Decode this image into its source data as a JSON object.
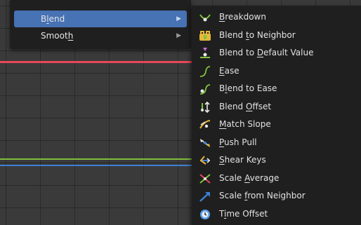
{
  "parent_menu": {
    "items": [
      {
        "pre": "B",
        "ul": "l",
        "post": "end",
        "active": true
      },
      {
        "pre": "Smoot",
        "ul": "h",
        "post": "",
        "active": false
      }
    ]
  },
  "blend_menu": {
    "items": [
      {
        "pre": "",
        "ul": "B",
        "post": "reakdown",
        "icon": "breakdown-icon"
      },
      {
        "pre": "Blend ",
        "ul": "t",
        "post": "o Neighbor",
        "icon": "blend-to-neighbor-icon"
      },
      {
        "pre": "Blend to ",
        "ul": "D",
        "post": "efault Value",
        "icon": "blend-to-default-icon"
      },
      {
        "pre": "",
        "ul": "E",
        "post": "ase",
        "icon": "ease-icon"
      },
      {
        "pre": "B",
        "ul": "l",
        "post": "end to Ease",
        "icon": "blend-to-ease-icon"
      },
      {
        "pre": "Blend ",
        "ul": "O",
        "post": "ffset",
        "icon": "blend-offset-icon"
      },
      {
        "pre": "",
        "ul": "M",
        "post": "atch Slope",
        "icon": "match-slope-icon"
      },
      {
        "pre": "",
        "ul": "P",
        "post": "ush Pull",
        "icon": "push-pull-icon"
      },
      {
        "pre": "",
        "ul": "S",
        "post": "hear Keys",
        "icon": "shear-keys-icon"
      },
      {
        "pre": "Scale ",
        "ul": "A",
        "post": "verage",
        "icon": "scale-average-icon"
      },
      {
        "pre": "Scale ",
        "ul": "f",
        "post": "rom Neighbor",
        "icon": "scale-from-neighbor-icon"
      },
      {
        "pre": "T",
        "ul": "i",
        "post": "me Offset",
        "icon": "time-offset-icon"
      }
    ]
  },
  "colors": {
    "highlight": "#4772b3",
    "menu_bg": "#1f1f1f",
    "curve_red": "#e8485a",
    "curve_green": "#7fbf3a",
    "curve_blue": "#3d7fd1"
  }
}
